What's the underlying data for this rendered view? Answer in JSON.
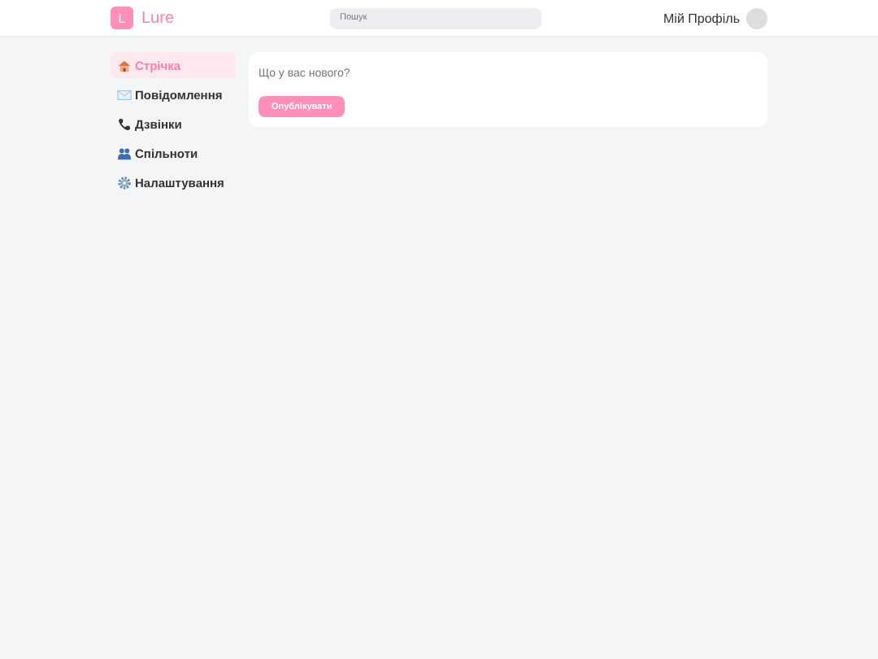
{
  "header": {
    "logo_letter": "L",
    "brand": "Lure",
    "search": {
      "placeholder": "Пошук"
    },
    "profile": "Мій Профіль"
  },
  "sidebar": {
    "items": [
      {
        "label": "Стрічка",
        "selected": true
      },
      {
        "label": "Повідомлення",
        "selected": false
      },
      {
        "label": "Дзвінки",
        "selected": false
      },
      {
        "label": "Спільноти",
        "selected": false
      },
      {
        "label": "Налаштування",
        "selected": false
      }
    ]
  },
  "composer": {
    "placeholder": "Що у вас нового?",
    "button": "Опублікувати"
  }
}
